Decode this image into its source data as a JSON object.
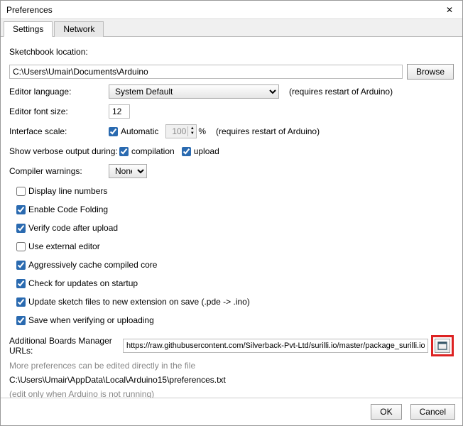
{
  "window": {
    "title": "Preferences"
  },
  "tabs": {
    "settings": "Settings",
    "network": "Network"
  },
  "sketchbook": {
    "label": "Sketchbook location:",
    "value": "C:\\Users\\Umair\\Documents\\Arduino",
    "browse": "Browse"
  },
  "editor_language": {
    "label": "Editor language:",
    "value": "System Default",
    "note": "(requires restart of Arduino)"
  },
  "editor_font": {
    "label": "Editor font size:",
    "value": "12"
  },
  "interface_scale": {
    "label": "Interface scale:",
    "auto_label": "Automatic",
    "auto_checked": true,
    "value": "100",
    "pct": "%",
    "note": "(requires restart of Arduino)"
  },
  "verbose": {
    "label": "Show verbose output during:",
    "compilation_label": "compilation",
    "compilation_checked": true,
    "upload_label": "upload",
    "upload_checked": true
  },
  "compiler_warnings": {
    "label": "Compiler warnings:",
    "value": "None"
  },
  "options": {
    "display_line_numbers": {
      "label": "Display line numbers",
      "checked": false
    },
    "enable_code_folding": {
      "label": "Enable Code Folding",
      "checked": true
    },
    "verify_after_upload": {
      "label": "Verify code after upload",
      "checked": true
    },
    "external_editor": {
      "label": "Use external editor",
      "checked": false
    },
    "aggr_cache": {
      "label": "Aggressively cache compiled core",
      "checked": true
    },
    "check_updates": {
      "label": "Check for updates on startup",
      "checked": true
    },
    "update_ext": {
      "label": "Update sketch files to new extension on save (.pde -> .ino)",
      "checked": true
    },
    "save_when_verify": {
      "label": "Save when verifying or uploading",
      "checked": true
    }
  },
  "boards_url": {
    "label": "Additional Boards Manager URLs:",
    "value": "https://raw.githubusercontent.com/Silverback-Pvt-Ltd/surilli.io/master/package_surilli.io_index.json"
  },
  "more_prefs": {
    "line1": "More preferences can be edited directly in the file",
    "path": "C:\\Users\\Umair\\AppData\\Local\\Arduino15\\preferences.txt",
    "line2": "(edit only when Arduino is not running)"
  },
  "buttons": {
    "ok": "OK",
    "cancel": "Cancel"
  }
}
